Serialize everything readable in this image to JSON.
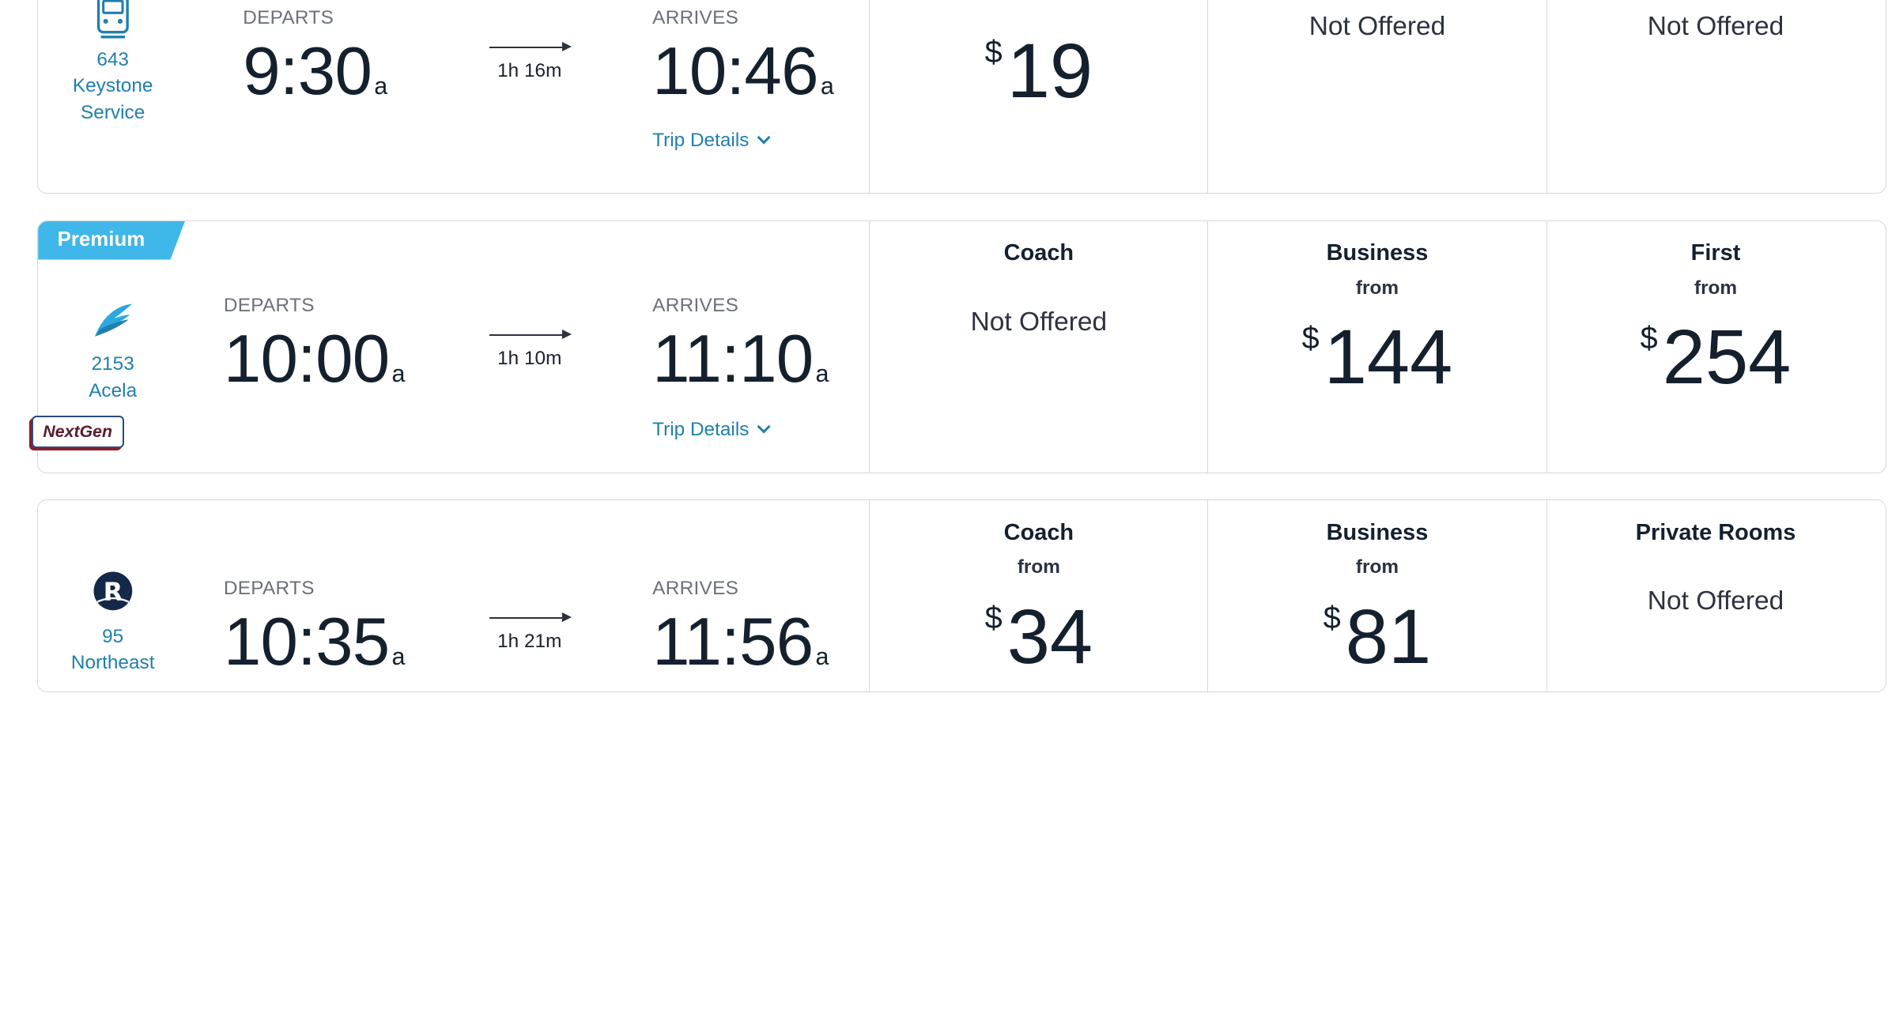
{
  "rows": [
    {
      "train_number": "643",
      "train_name_line1": "Keystone",
      "train_name_line2": "Service",
      "icon": "keystone-train-icon",
      "departs_label": "DEPARTS",
      "departs_time": "9:30",
      "departs_ampm": "a",
      "duration": "1h 16m",
      "arrives_label": "ARRIVES",
      "arrives_time": "10:46",
      "arrives_ampm": "a",
      "trip_details": "Trip Details",
      "fares": [
        {
          "currency": "$",
          "price": "19"
        },
        {
          "status": "Not Offered"
        },
        {
          "status": "Not Offered"
        }
      ]
    },
    {
      "badge": "Premium",
      "train_number": "2153",
      "train_name_line1": "Acela",
      "icon": "acela-wing-icon",
      "nextgen_badge": "NextGen",
      "departs_label": "DEPARTS",
      "departs_time": "10:00",
      "departs_ampm": "a",
      "duration": "1h 10m",
      "arrives_label": "ARRIVES",
      "arrives_time": "11:10",
      "arrives_ampm": "a",
      "trip_details": "Trip Details",
      "fares": [
        {
          "class": "Coach",
          "status": "Not Offered"
        },
        {
          "class": "Business",
          "from": "from",
          "currency": "$",
          "price": "144"
        },
        {
          "class": "First",
          "from": "from",
          "currency": "$",
          "price": "254"
        }
      ]
    },
    {
      "train_number": "95",
      "train_name_line1": "Northeast",
      "icon": "regional-r-icon",
      "departs_label": "DEPARTS",
      "departs_time": "10:35",
      "departs_ampm": "a",
      "duration": "1h 21m",
      "arrives_label": "ARRIVES",
      "arrives_time": "11:56",
      "arrives_ampm": "a",
      "fares": [
        {
          "class": "Coach",
          "from": "from",
          "currency": "$",
          "price": "34"
        },
        {
          "class": "Business",
          "from": "from",
          "currency": "$",
          "price": "81"
        },
        {
          "class": "Private Rooms",
          "status": "Not Offered"
        }
      ]
    }
  ],
  "colors": {
    "link": "#1f7fad",
    "premium": "#3fb7e8",
    "border": "#d3d7dc",
    "text": "#14202e"
  }
}
